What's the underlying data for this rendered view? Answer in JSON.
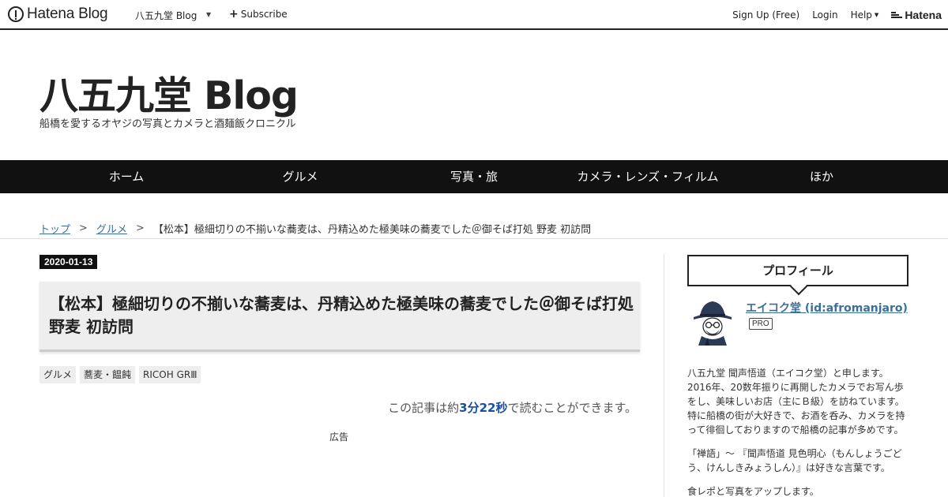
{
  "topbar": {
    "logo_text": "Hatena Blog",
    "blog_name": "八五九堂 Blog",
    "subscribe": "Subscribe",
    "signup": "Sign Up (Free)",
    "login": "Login",
    "help": "Help",
    "hatena": "Hatena"
  },
  "blog": {
    "title": "八五九堂 Blog",
    "description": "船橋を愛するオヤジの写真とカメラと酒麺飯クロニクル"
  },
  "nav": {
    "items": [
      {
        "label": "ホーム"
      },
      {
        "label": "グルメ"
      },
      {
        "label": "写真・旅"
      },
      {
        "label": "カメラ・レンズ・フィルム"
      },
      {
        "label": "ほか"
      }
    ]
  },
  "breadcrumb": {
    "top": "トップ",
    "sep": ">",
    "category": "グルメ",
    "current": "【松本】極細切りの不揃いな蕎麦は、丹精込めた極美味の蕎麦でした＠御そば打処 野麦 初訪問"
  },
  "post": {
    "date": "2020-01-13",
    "title": "【松本】極細切りの不揃いな蕎麦は、丹精込めた極美味の蕎麦でした＠御そば打処 野麦 初訪問",
    "categories": [
      "グルメ",
      "蕎麦・饂飩",
      "RICOH GRⅢ"
    ],
    "read_prefix": "この記事は約",
    "read_time": "3分22秒",
    "read_suffix": "で読むことができます。",
    "ad_label": "広告"
  },
  "sidebar": {
    "profile_heading": "プロフィール",
    "name": "エイコク堂 (id:afromanjaro)",
    "badge": "PRO",
    "bio1": "八五九堂 聞声悟道（エイコク堂）と申します。2016年、20数年振りに再開したカメラでお写ん歩をし、美味しいお店（主にＢ級）を訪ねています。特に船橋の街が大好きで、お酒を呑み、カメラを持って徘徊しておりますので船橋の記事が多めです。",
    "bio2": "「禅語」～ 『聞声悟道 見色明心（もんしょうごどう、けんしきみょうしん）』は好きな言葉です。",
    "bio3": "食レポと写真をアップします。"
  },
  "colors": {
    "nav_bg": "#111111",
    "link": "#3b6f9a",
    "read_accent": "#1a4fa3"
  }
}
